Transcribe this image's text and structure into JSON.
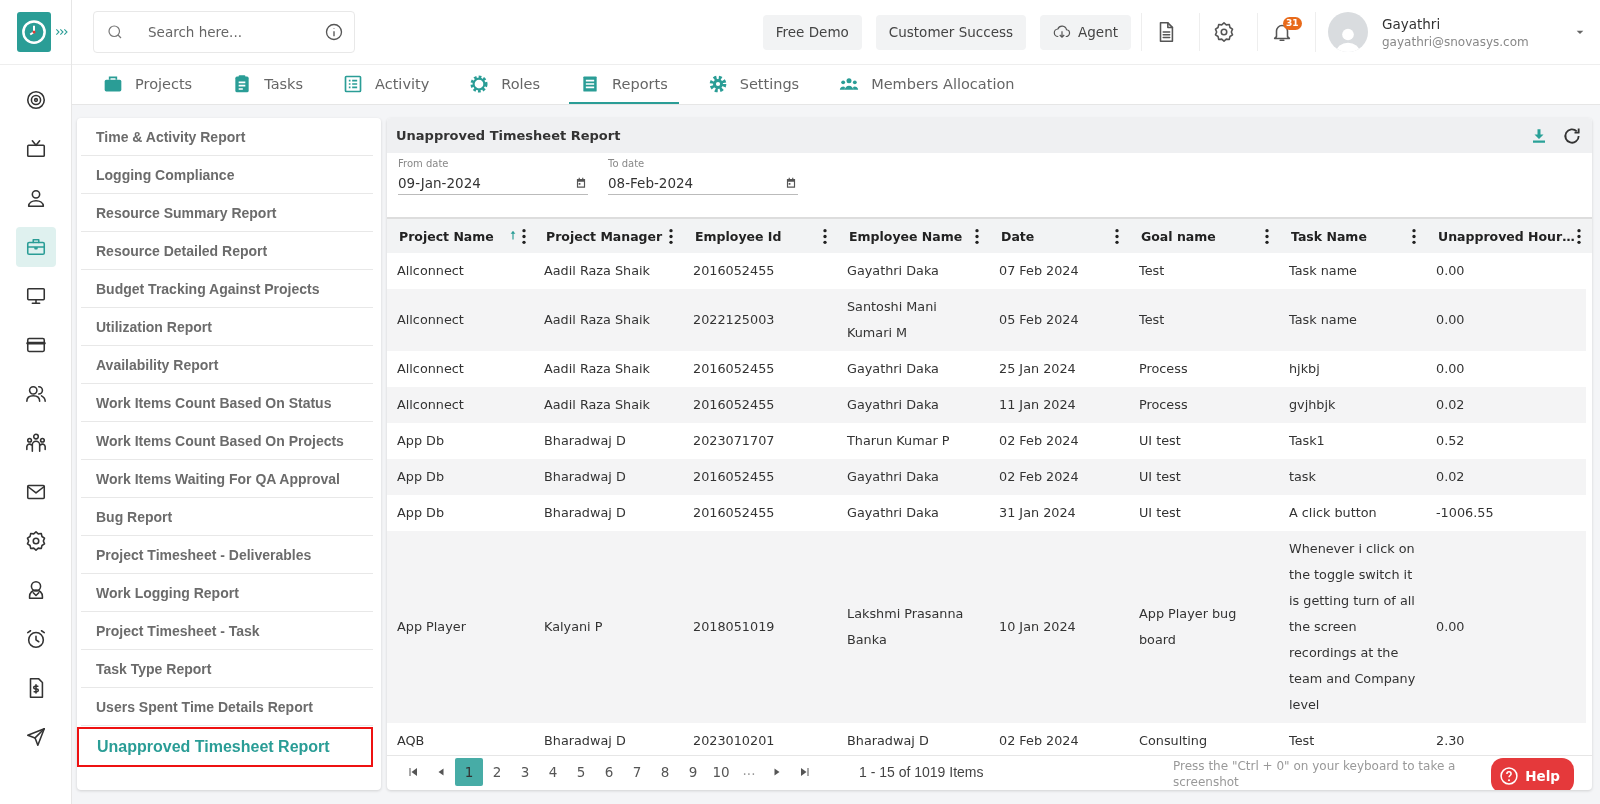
{
  "rail": {
    "items": [
      {
        "selected": false
      },
      {
        "selected": false
      },
      {
        "selected": false
      },
      {
        "selected": true
      },
      {
        "selected": false
      },
      {
        "selected": false
      },
      {
        "selected": false
      },
      {
        "selected": false
      },
      {
        "selected": false
      },
      {
        "selected": false
      },
      {
        "selected": false
      },
      {
        "selected": false
      },
      {
        "selected": false
      },
      {
        "selected": false
      }
    ]
  },
  "header": {
    "search": {
      "placeholder": "Search here..."
    },
    "buttons": [
      {
        "label": "Free Demo",
        "kind": "plain"
      },
      {
        "label": "Customer Success",
        "kind": "plain"
      },
      {
        "label": "Agent",
        "kind": "cloud"
      }
    ],
    "notifications": {
      "count": "31"
    },
    "user": {
      "name": "Gayathri",
      "email": "gayathri@snovasys.com"
    }
  },
  "tabs": [
    {
      "label": "Projects",
      "selected": false
    },
    {
      "label": "Tasks",
      "selected": false
    },
    {
      "label": "Activity",
      "selected": false
    },
    {
      "label": "Roles",
      "selected": false
    },
    {
      "label": "Reports",
      "selected": true
    },
    {
      "label": "Settings",
      "selected": false
    },
    {
      "label": "Members Allocation",
      "selected": false
    }
  ],
  "report_menu": {
    "items": [
      {
        "label": "Time & Activity Report",
        "selected": false
      },
      {
        "label": "Logging Compliance",
        "selected": false
      },
      {
        "label": "Resource Summary Report",
        "selected": false
      },
      {
        "label": "Resource Detailed Report",
        "selected": false
      },
      {
        "label": "Budget Tracking Against Projects",
        "selected": false
      },
      {
        "label": "Utilization Report",
        "selected": false
      },
      {
        "label": "Availability Report",
        "selected": false
      },
      {
        "label": "Work Items Count Based On Status",
        "selected": false
      },
      {
        "label": "Work Items Count Based On Projects",
        "selected": false
      },
      {
        "label": "Work Items Waiting For QA Approval",
        "selected": false
      },
      {
        "label": "Bug Report",
        "selected": false
      },
      {
        "label": "Project Timesheet - Deliverables",
        "selected": false
      },
      {
        "label": "Work Logging Report",
        "selected": false
      },
      {
        "label": "Project Timesheet - Task",
        "selected": false
      },
      {
        "label": "Task Type Report",
        "selected": false
      },
      {
        "label": "Users Spent Time Details Report",
        "selected": false
      },
      {
        "label": "Unapproved Timesheet Report",
        "selected": true
      }
    ]
  },
  "report": {
    "title": "Unapproved Timesheet Report",
    "filters": [
      {
        "label": "From date",
        "value": "09-Jan-2024"
      },
      {
        "label": "To date",
        "value": "08-Feb-2024"
      }
    ],
    "table": {
      "columns": [
        {
          "label": "Project Name",
          "sorted": true
        },
        {
          "label": "Project Manager",
          "sorted": false
        },
        {
          "label": "Employee Id",
          "sorted": false
        },
        {
          "label": "Employee Name",
          "sorted": false
        },
        {
          "label": "Date",
          "sorted": false
        },
        {
          "label": "Goal name",
          "sorted": false
        },
        {
          "label": "Task Name",
          "sorted": false
        },
        {
          "label": "Unapproved Hour…",
          "sorted": false
        }
      ],
      "rows": [
        [
          "Allconnect",
          "Aadil Raza Shaik",
          "2016052455",
          "Gayathri Daka",
          "07 Feb 2024",
          "Test",
          "Task name",
          "0.00"
        ],
        [
          "Allconnect",
          "Aadil Raza Shaik",
          "2022125003",
          "Santoshi Mani Kumari M",
          "05 Feb 2024",
          "Test",
          "Task name",
          "0.00"
        ],
        [
          "Allconnect",
          "Aadil Raza Shaik",
          "2016052455",
          "Gayathri Daka",
          "25 Jan 2024",
          "Process",
          "hjkbj",
          "0.00"
        ],
        [
          "Allconnect",
          "Aadil Raza Shaik",
          "2016052455",
          "Gayathri Daka",
          "11 Jan 2024",
          "Process",
          "gvjhbjk",
          "0.02"
        ],
        [
          "App Db",
          "Bharadwaj D",
          "2023071707",
          "Tharun Kumar P",
          "02 Feb 2024",
          "UI test",
          "Task1",
          "0.52"
        ],
        [
          "App Db",
          "Bharadwaj D",
          "2016052455",
          "Gayathri Daka",
          "02 Feb 2024",
          "UI test",
          "task",
          "0.02"
        ],
        [
          "App Db",
          "Bharadwaj D",
          "2016052455",
          "Gayathri Daka",
          "31 Jan 2024",
          "UI test",
          "A click button",
          "-1006.55"
        ],
        [
          "App Player",
          "Kalyani P",
          "2018051019",
          "Lakshmi Prasanna Banka",
          "10 Jan 2024",
          "App Player bug board",
          "Whenever i click on the toggle switch it is getting turn of all the screen recordings at the team and Company level",
          "0.00"
        ],
        [
          "AQB",
          "Bharadwaj D",
          "2023010201",
          "Bharadwaj D",
          "02 Feb 2024",
          "Consulting",
          "Test",
          "2.30"
        ]
      ]
    },
    "pagination": {
      "pages": [
        {
          "label": "1",
          "selected": true
        },
        {
          "label": "2",
          "selected": false
        },
        {
          "label": "3",
          "selected": false
        },
        {
          "label": "4",
          "selected": false
        },
        {
          "label": "5",
          "selected": false
        },
        {
          "label": "6",
          "selected": false
        },
        {
          "label": "7",
          "selected": false
        },
        {
          "label": "8",
          "selected": false
        },
        {
          "label": "9",
          "selected": false
        },
        {
          "label": "10",
          "selected": false
        }
      ],
      "more": "...",
      "summary": "1 - 15 of 1019 Items"
    }
  },
  "toast": {
    "message": "Press the \"Ctrl + 0\" on your keyboard to take a screenshot"
  },
  "help": {
    "label": "Help"
  }
}
